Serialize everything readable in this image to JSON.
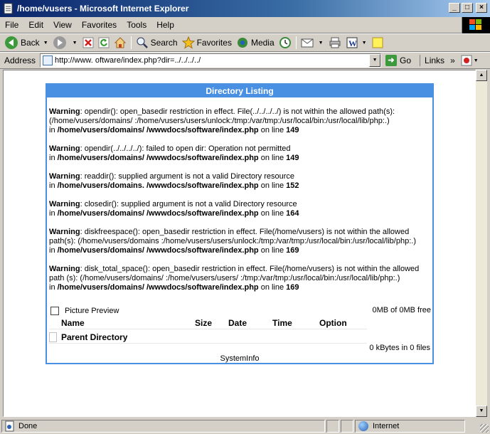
{
  "window": {
    "title": "/home/vusers - Microsoft Internet Explorer",
    "controls": [
      "_",
      "□",
      "×"
    ]
  },
  "menu": [
    "File",
    "Edit",
    "View",
    "Favorites",
    "Tools",
    "Help"
  ],
  "toolbar": {
    "back": "Back",
    "search": "Search",
    "favorites": "Favorites",
    "media": "Media"
  },
  "address": {
    "label": "Address",
    "url": "http://www.                    oftware/index.php?dir=../../../../",
    "go": "Go",
    "links": "Links"
  },
  "panel": {
    "title": "Directory Listing",
    "messages": [
      {
        "label": "Warning",
        "text": ": opendir(): open_basedir restriction in effect. File(../../../../) is not within the allowed path(s): (/home/vusers/domains/              :/home/vusers/users/unlock:/tmp:/var/tmp:/usr/local/bin:/usr/local/lib/php:.)",
        "in": "in ",
        "path": "/home/vusers/domains/              /wwwdocs/software/index.php",
        "line_prefix": " on line ",
        "line": "149"
      },
      {
        "label": "Warning",
        "text": ": opendir(../../../../): failed to open dir: Operation not permitted",
        "in": "in ",
        "path": "/home/vusers/domains/              /wwwdocs/software/index.php",
        "line_prefix": " on line ",
        "line": "149"
      },
      {
        "label": "Warning",
        "text": ": readdir(): supplied argument is not a valid Directory resource",
        "in": "in ",
        "path": "/home/vusers/domains.          /wwwdocs/software/index.php",
        "line_prefix": " on line ",
        "line": "152"
      },
      {
        "label": "Warning",
        "text": ": closedir(): supplied argument is not a valid Directory resource",
        "in": "in ",
        "path": "/home/vusers/domains/          /wwwdocs/software/index.php",
        "line_prefix": " on line ",
        "line": "164"
      },
      {
        "label": "Warning",
        "text": ": diskfreespace(): open_basedir restriction in effect. File(/home/vusers) is not within the allowed path(s): (/home/vusers/domains            :/home/vusers/users/unlock:/tmp:/var/tmp:/usr/local/bin:/usr/local/lib/php:.)",
        "in": "in ",
        "path": "/home/vusers/domains/              /wwwdocs/software/index.php",
        "line_prefix": " on line ",
        "line": "169"
      },
      {
        "label": "Warning",
        "text": ": disk_total_space(): open_basedir restriction in effect. File(/home/vusers) is not within the allowed path (s): (/home/vusers/domains/              :/home/vusers/users/          :/tmp:/var/tmp:/usr/local/bin:/usr/local/lib/php:.)",
        "in": "in ",
        "path": "/home/vusers/domains/              /wwwdocs/software/index.php",
        "line_prefix": " on line ",
        "line": "169"
      }
    ],
    "picture_preview": "Picture Preview",
    "free_space": "0MB of 0MB free",
    "columns": [
      "Name",
      "Size",
      "Date",
      "Time",
      "Option"
    ],
    "parent_dir": "Parent Directory",
    "summary": "0 kBytes in 0 files",
    "sysinfo": "SystemInfo"
  },
  "status": {
    "text": "Done",
    "zone": "Internet"
  },
  "colors": {
    "panel_accent": "#4a90e2",
    "title_gradient_start": "#0a246a",
    "chrome": "#d4d0c8"
  }
}
